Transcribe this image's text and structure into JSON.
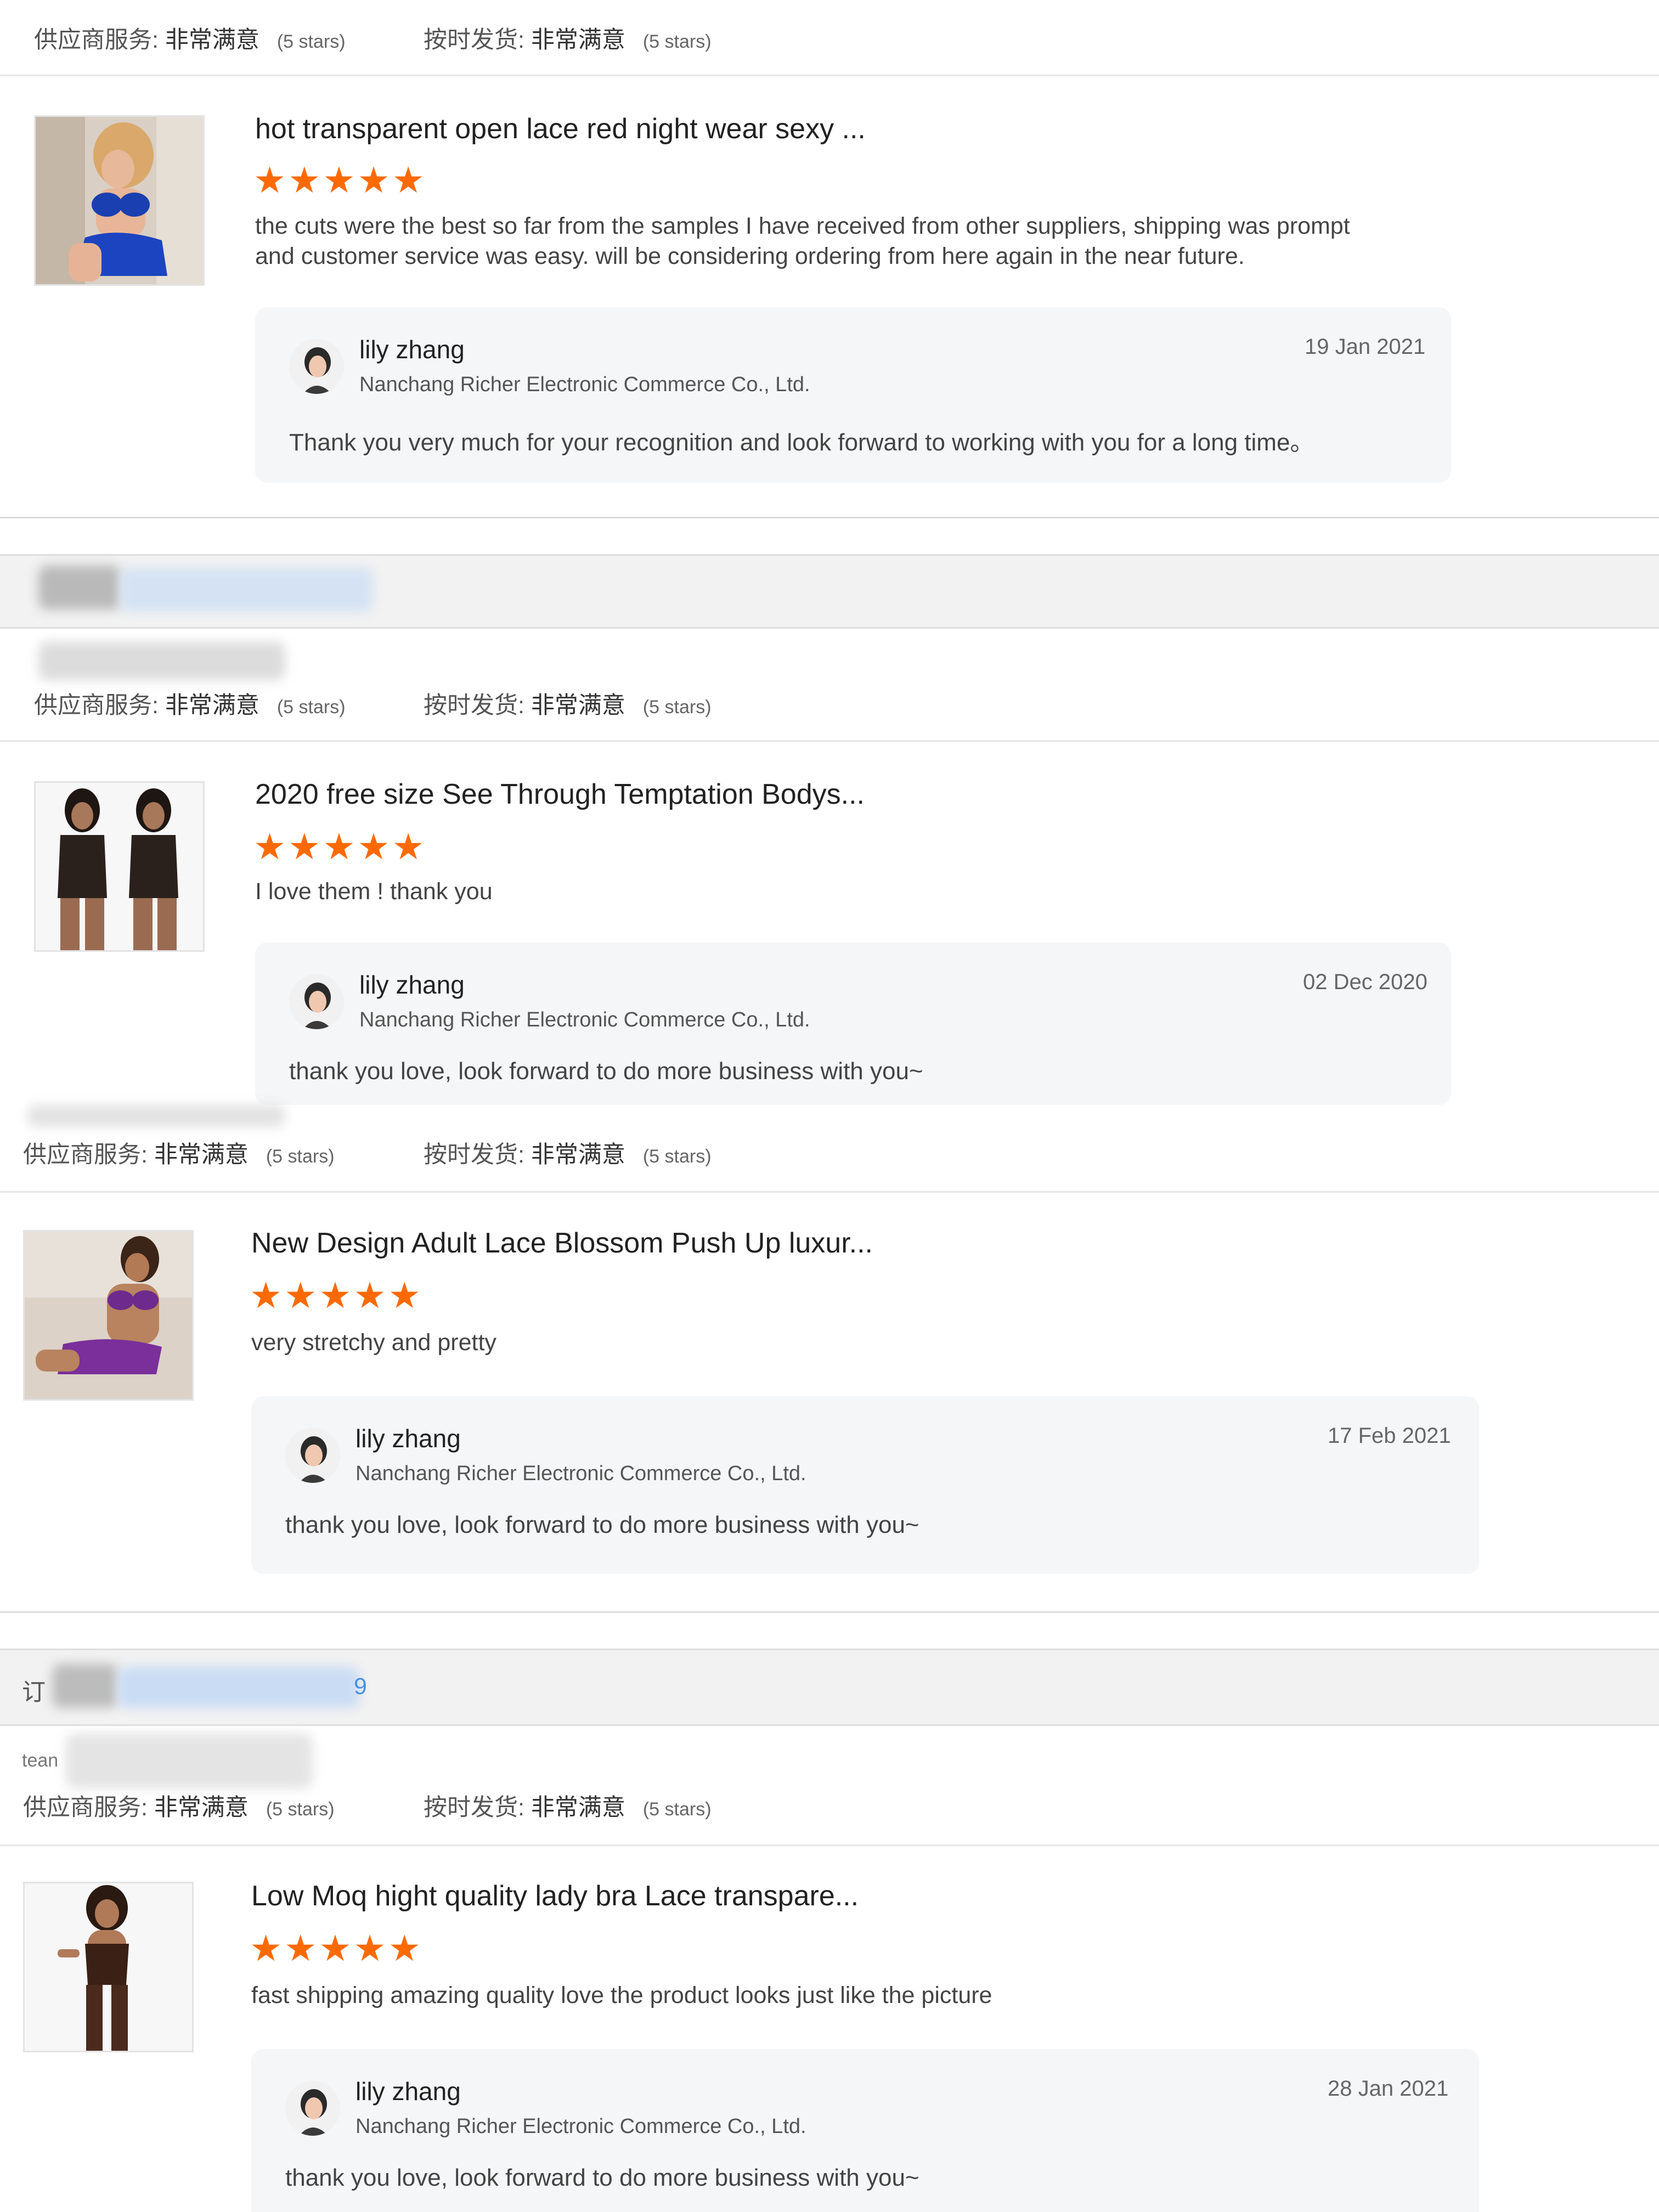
{
  "ratings": {
    "supplier_label": "供应商服务:",
    "supplier_value": "非常满意",
    "shipping_label": "按时发货:",
    "shipping_value": "非常满意",
    "stars_text": "(5 stars)"
  },
  "order_fragments": {
    "prefix": "订",
    "suffix": "9",
    "team_prefix": "tean"
  },
  "reviews": [
    {
      "product_title": "hot transparent open lace red night wear sexy ...",
      "stars": "★★★★★",
      "comment": "the cuts were the best so far from the samples I have received from other suppliers, shipping was prompt and customer service was easy. will be considering ordering from here again in the near future.",
      "reply": {
        "name": "lily zhang",
        "company": "Nanchang Richer Electronic Commerce Co., Ltd.",
        "date": "19 Jan 2021",
        "text": "Thank you very much for your recognition and look forward to working with you for a long time。"
      }
    },
    {
      "product_title": "2020 free size See Through Temptation Bodys...",
      "stars": "★★★★★",
      "comment": "I love them ! thank you",
      "reply": {
        "name": "lily zhang",
        "company": "Nanchang Richer Electronic Commerce Co., Ltd.",
        "date": "02 Dec 2020",
        "text": "thank you love, look forward to do more business with you~"
      }
    },
    {
      "product_title": "New Design Adult Lace Blossom Push Up luxur...",
      "stars": "★★★★★",
      "comment": "very stretchy and pretty",
      "reply": {
        "name": "lily zhang",
        "company": "Nanchang Richer Electronic Commerce Co., Ltd.",
        "date": "17 Feb 2021",
        "text": "thank you love, look forward to do more business with you~"
      }
    },
    {
      "product_title": "Low Moq hight quality lady bra Lace transpare...",
      "stars": "★★★★★",
      "comment": "fast shipping amazing quality love the product looks just like the picture",
      "reply": {
        "name": "lily zhang",
        "company": "Nanchang Richer Electronic Commerce Co., Ltd.",
        "date": "28 Jan 2021",
        "text": "thank you love, look forward to do more business with you~"
      }
    }
  ],
  "colors": {
    "star_orange": "#ff6a00",
    "reply_bg": "#f5f6f8",
    "order_strip_bg": "#f2f2f2",
    "link_blue": "#4a90e2"
  }
}
